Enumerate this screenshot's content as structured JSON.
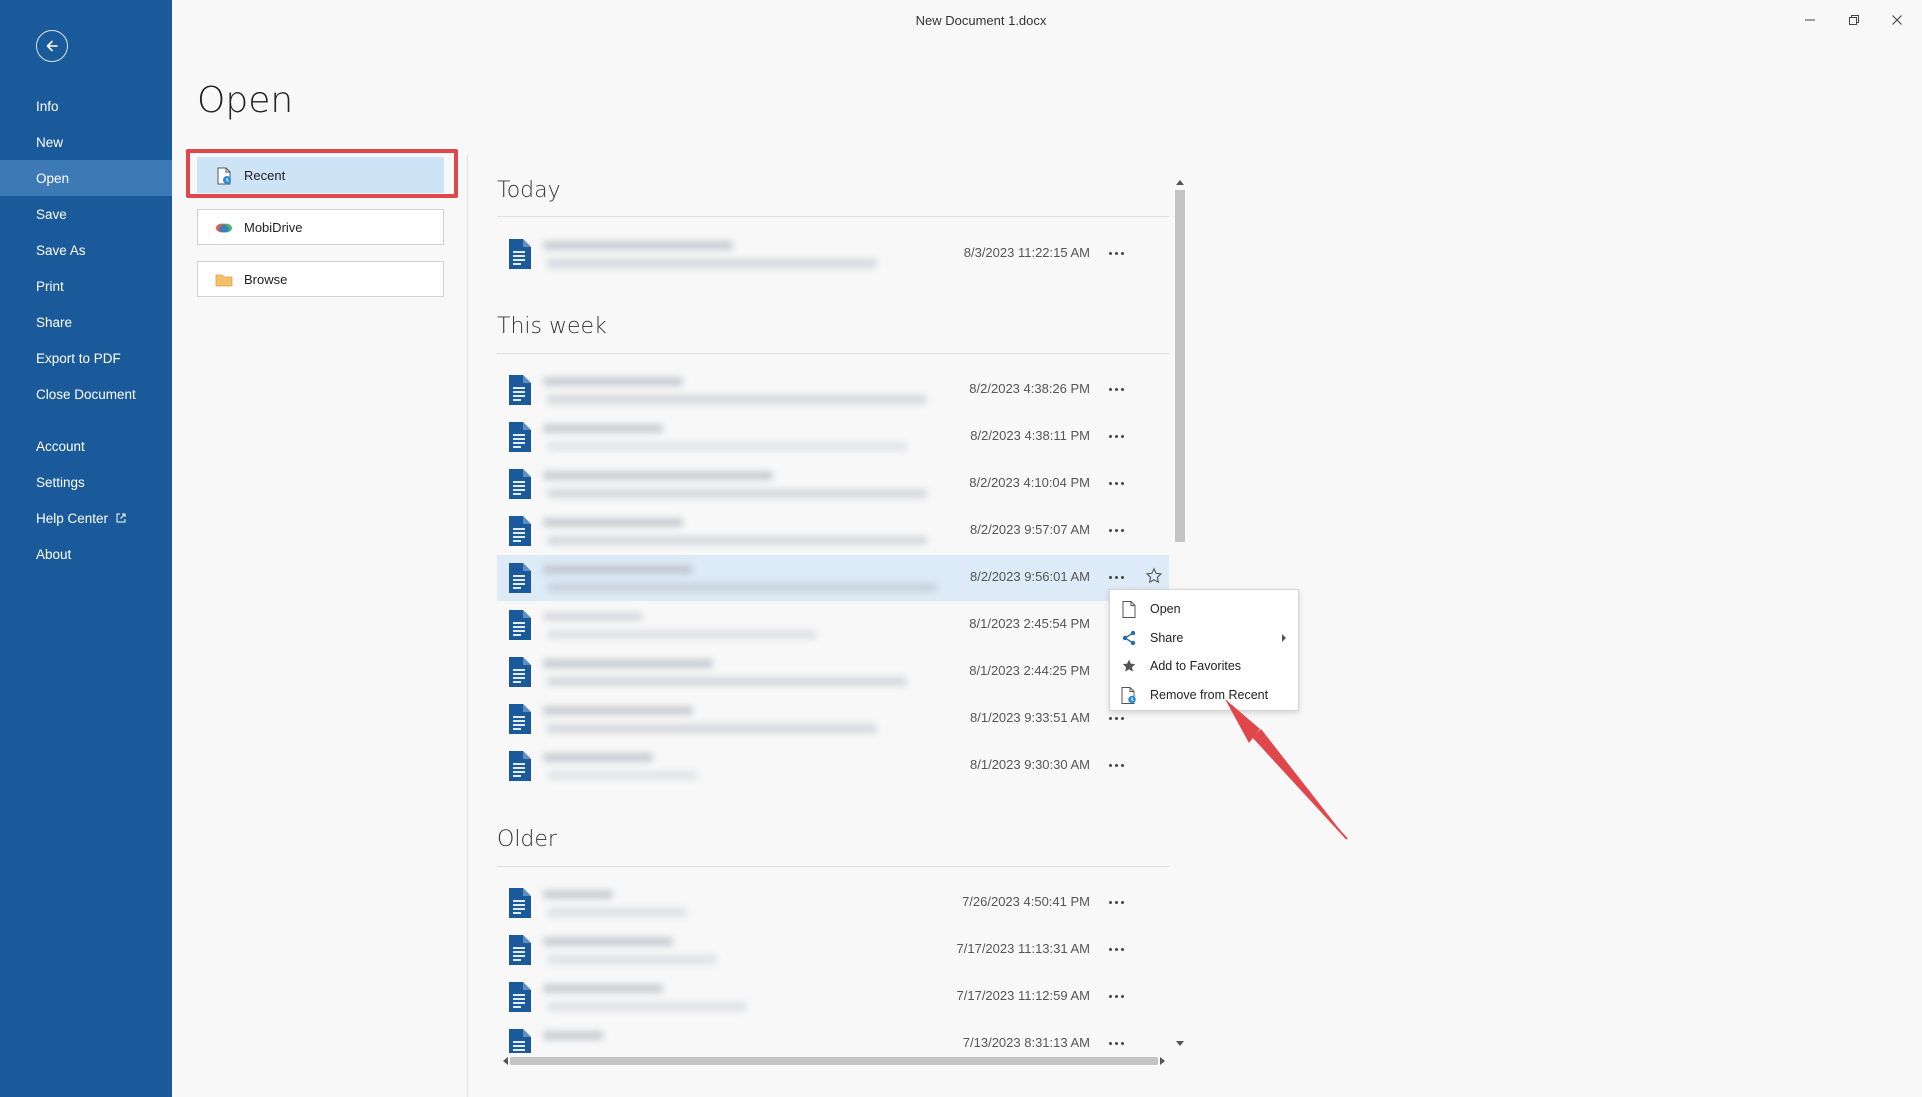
{
  "window": {
    "title": "New Document 1.docx"
  },
  "sidebar": {
    "items": [
      {
        "label": "Info"
      },
      {
        "label": "New"
      },
      {
        "label": "Open",
        "active": true
      },
      {
        "label": "Save"
      },
      {
        "label": "Save As"
      },
      {
        "label": "Print"
      },
      {
        "label": "Share"
      },
      {
        "label": "Export to PDF"
      },
      {
        "label": "Close Document"
      },
      {
        "label": "Account"
      },
      {
        "label": "Settings"
      },
      {
        "label": "Help Center"
      },
      {
        "label": "About"
      }
    ]
  },
  "page": {
    "title": "Open"
  },
  "locations": [
    {
      "label": "Recent",
      "icon": "recent-doc-icon",
      "active": true
    },
    {
      "label": "MobiDrive",
      "icon": "mobidrive-icon"
    },
    {
      "label": "Browse",
      "icon": "folder-icon"
    }
  ],
  "sections": [
    {
      "heading": "Today",
      "files": [
        {
          "date": "8/3/2023 11:22:15 AM"
        }
      ]
    },
    {
      "heading": "This week",
      "files": [
        {
          "date": "8/2/2023 4:38:26 PM"
        },
        {
          "date": "8/2/2023 4:38:11 PM"
        },
        {
          "date": "8/2/2023 4:10:04 PM"
        },
        {
          "date": "8/2/2023 9:57:07 AM"
        },
        {
          "date": "8/2/2023 9:56:01 AM",
          "hover": true
        },
        {
          "date": "8/1/2023 2:45:54 PM"
        },
        {
          "date": "8/1/2023 2:44:25 PM"
        },
        {
          "date": "8/1/2023 9:33:51 AM"
        },
        {
          "date": "8/1/2023 9:30:30 AM"
        }
      ]
    },
    {
      "heading": "Older",
      "files": [
        {
          "date": "7/26/2023 4:50:41 PM"
        },
        {
          "date": "7/17/2023 11:13:31 AM"
        },
        {
          "date": "7/17/2023 11:12:59 AM"
        },
        {
          "date": "7/13/2023 8:31:13 AM"
        }
      ]
    }
  ],
  "context_menu": {
    "items": [
      {
        "label": "Open",
        "icon": "document-icon"
      },
      {
        "label": "Share",
        "icon": "share-icon",
        "submenu": true
      },
      {
        "label": "Add to Favorites",
        "icon": "star-icon"
      },
      {
        "label": "Remove from Recent",
        "icon": "remove-recent-icon"
      }
    ]
  },
  "colors": {
    "sidebar": "#1a5a9a",
    "sidebar_active": "#3d7ab5",
    "recent_active": "#cce4f6",
    "doc_icon": "#1a5a9a",
    "annotation": "#e0474c"
  }
}
